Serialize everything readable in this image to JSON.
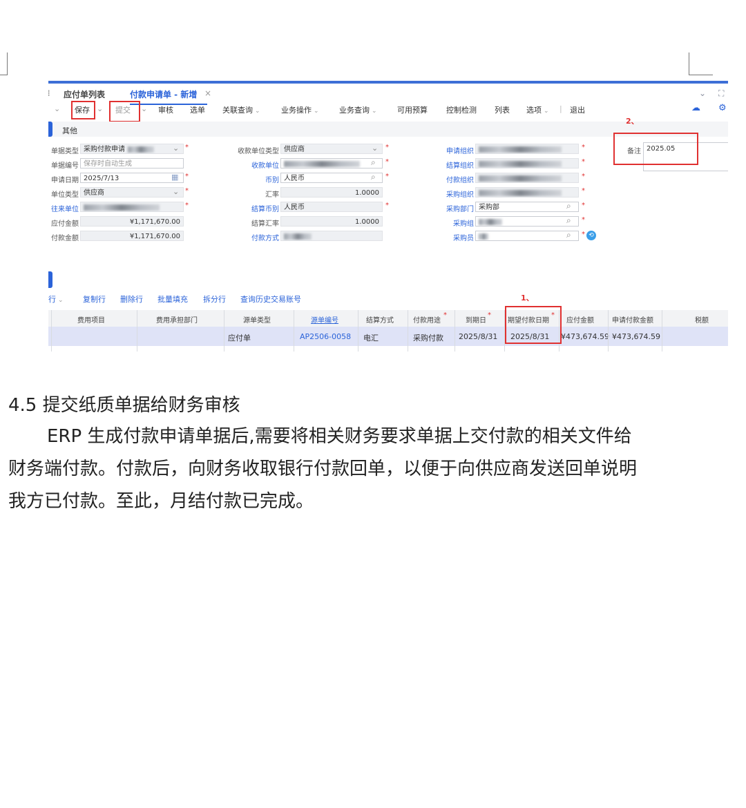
{
  "tabs": {
    "list": "应付单列表",
    "active": "付款申请单 - 新增"
  },
  "toolbar": {
    "save": "保存",
    "submit": "提交",
    "audit": "审核",
    "select": "选单",
    "related": "关联查询",
    "bizop": "业务操作",
    "bizquery": "业务查询",
    "budget": "可用预算",
    "control": "控制检测",
    "listing": "列表",
    "options": "选项",
    "sep": "|",
    "exit": "退出"
  },
  "section_other": "其他",
  "form": {
    "doc_type_label": "单据类型",
    "doc_type_value": "采购付款申请",
    "doc_no_label": "单据编号",
    "doc_no_placeholder": "保存时自动生成",
    "apply_date_label": "申请日期",
    "apply_date_value": "2025/7/13",
    "unit_type_label": "单位类型",
    "unit_type_value": "供应商",
    "partner_label": "往来单位",
    "payable_amount_label": "应付金额",
    "payable_amount_value": "¥1,171,670.00",
    "apply_amount_label": "付款金额",
    "apply_amount_value": "¥1,171,670.00",
    "payee_type_label": "收款单位类型",
    "payee_type_value": "供应商",
    "payee_label": "收款单位",
    "currency_label": "币别",
    "currency_value": "人民币",
    "rate_label": "汇率",
    "rate_value": "1.0000",
    "settle_currency_label": "结算币别",
    "settle_currency_value": "人民币",
    "settle_rate_label": "结算汇率",
    "settle_rate_value": "1.0000",
    "pay_method_label": "付款方式",
    "apply_org_label": "申请组织",
    "settle_org_label": "结算组织",
    "pay_org_label": "付款组织",
    "purchase_org_label": "采购组织",
    "purchase_dept_label": "采购部门",
    "purchase_dept_value": "采购部",
    "purchase_group_label": "采购组",
    "purchaser_label": "采购员",
    "remark_label": "备注",
    "remark_value": "2025.05"
  },
  "annot": {
    "one": "1、",
    "two": "2、"
  },
  "grid_toolbar": {
    "row": "行",
    "copy": "复制行",
    "delete": "删除行",
    "batch": "批量填充",
    "split": "拆分行",
    "history": "查询历史交易账号"
  },
  "grid": {
    "headers": [
      "费用项目",
      "费用承担部门",
      "源单类型",
      "源单编号",
      "结算方式",
      "付款用途",
      "到期日",
      "期望付款日期",
      "应付金额",
      "申请付款金额",
      "税额"
    ],
    "row": [
      "",
      "",
      "应付单",
      "AP2506-0058",
      "电汇",
      "采购付款",
      "2025/8/31",
      "2025/8/31",
      "¥473,674.59",
      "¥473,674.59",
      ""
    ]
  },
  "doc": {
    "heading": "4.5 提交纸质单据给财务审核",
    "p1": "ERP 生成付款申请单据后,需要将相关财务要求单据上交付款的相关文件给",
    "p2": "财务端付款。付款后，向财务收取银行付款回单，以便于向供应商发送回单说明",
    "p3": "我方已付款。至此，月结付款已完成。"
  },
  "colors": {
    "accent": "#2b63d9",
    "annot": "#e03030",
    "row_selected": "#dfe3f7"
  }
}
